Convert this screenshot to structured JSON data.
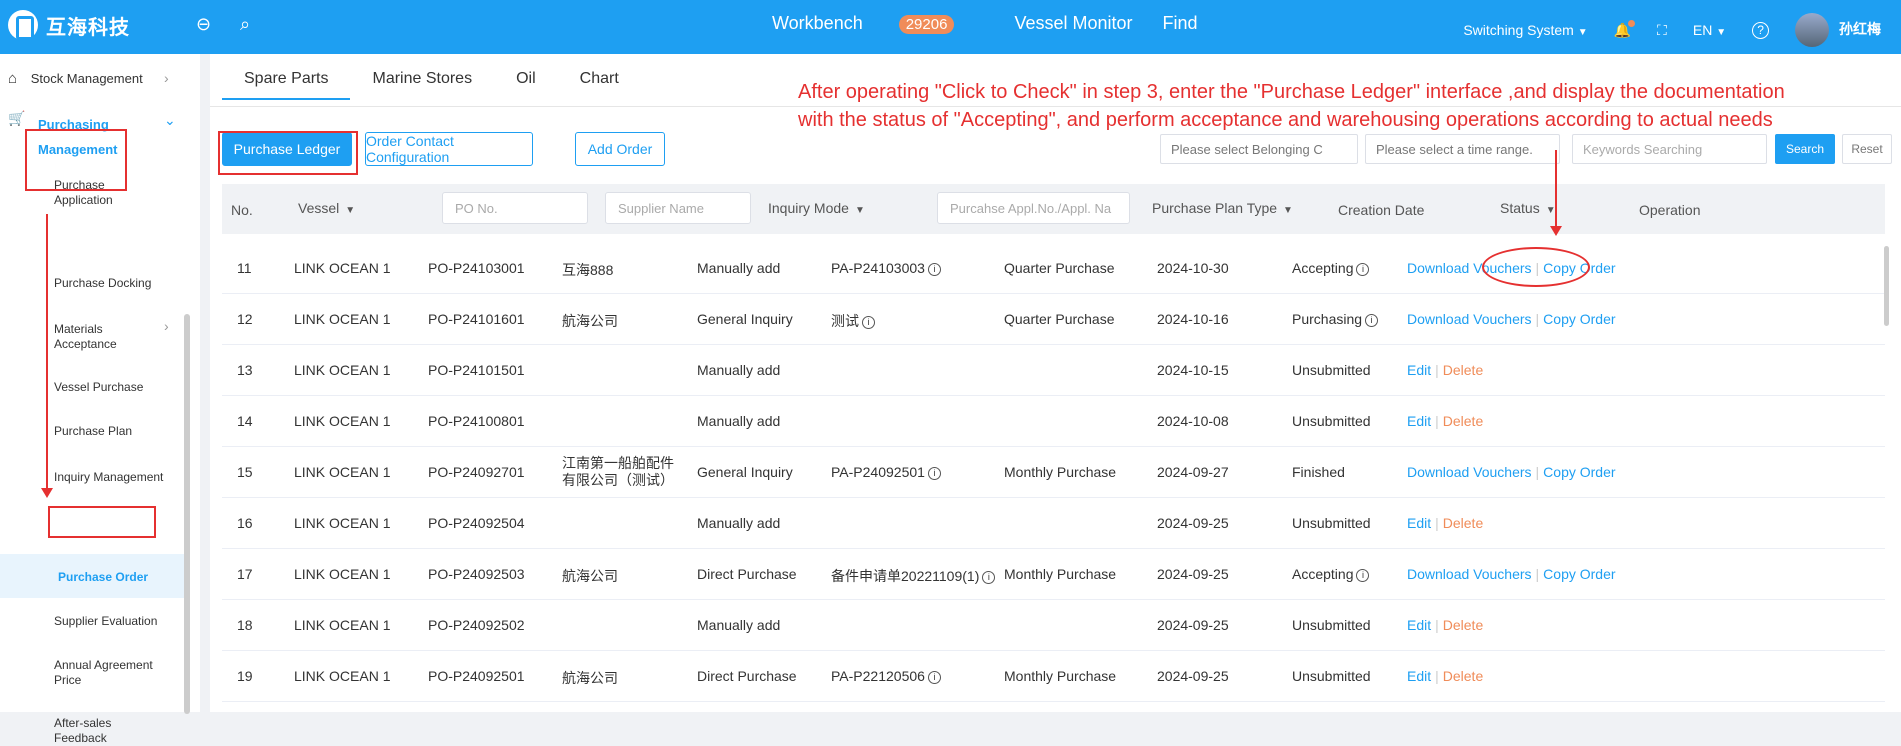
{
  "app": {
    "logo_text": "互海科技"
  },
  "topnav": {
    "workbench": "Workbench",
    "workbench_count": "29206",
    "vessel_monitor": "Vessel Monitor",
    "find": "Find"
  },
  "topright": {
    "switch_system": "Switching System",
    "language": "EN",
    "user_name": "孙红梅"
  },
  "sidebar": {
    "stock_management": "Stock Management",
    "purchasing_management_line1": "Purchasing",
    "purchasing_management_line2": "Management",
    "items": [
      "Purchase Application",
      "Purchase Docking",
      "Materials Acceptance",
      "Vessel Purchase",
      "Purchase Plan",
      "Inquiry Management",
      "Purchase Order",
      "Supplier Evaluation",
      "Annual Agreement Price",
      "After-sales Feedback"
    ]
  },
  "tabs": [
    "Spare Parts",
    "Marine Stores",
    "Oil",
    "Chart"
  ],
  "annotation": {
    "line1": "After operating \"Click to Check\" in step 3, enter the \"Purchase Ledger\" interface ,and display the documentation",
    "line2": "with the status of \"Accepting\", and perform acceptance and warehousing operations according to actual needs"
  },
  "toolbar": {
    "purchase_ledger": "Purchase Ledger",
    "order_contact_config": "Order Contact Configuration",
    "add_order": "Add Order",
    "belonging_placeholder": "Please select Belonging C",
    "time_range_placeholder": "Please select a time range.",
    "keywords_placeholder": "Keywords Searching",
    "search": "Search",
    "reset": "Reset"
  },
  "table": {
    "headers": {
      "no": "No.",
      "vessel": "Vessel",
      "po_placeholder": "PO No.",
      "supplier_placeholder": "Supplier Name",
      "inquiry_mode": "Inquiry Mode",
      "appl_placeholder": "Purcahse Appl.No./Appl. Na",
      "plan_type": "Purchase Plan Type",
      "creation_date": "Creation Date",
      "status": "Status",
      "operation": "Operation"
    },
    "rows": [
      {
        "no": "11",
        "vessel": "LINK OCEAN 1",
        "po": "PO-P24103001",
        "supplier": "互海888",
        "mode": "Manually add",
        "appl": "PA-P24103003",
        "plan": "Quarter Purchase",
        "date": "2024-10-30",
        "status": "Accepting",
        "status_info": true,
        "op1": "Download Vouchers",
        "op2": "Copy Order"
      },
      {
        "no": "12",
        "vessel": "LINK OCEAN 1",
        "po": "PO-P24101601",
        "supplier": "航海公司",
        "mode": "General Inquiry",
        "appl": "测试",
        "plan": "Quarter Purchase",
        "date": "2024-10-16",
        "status": "Purchasing",
        "status_info": true,
        "op1": "Download Vouchers",
        "op2": "Copy Order"
      },
      {
        "no": "13",
        "vessel": "LINK OCEAN 1",
        "po": "PO-P24101501",
        "supplier": "",
        "mode": "Manually add",
        "appl": "",
        "plan": "",
        "date": "2024-10-15",
        "status": "Unsubmitted",
        "status_info": false,
        "op1": "Edit",
        "op2": "Delete"
      },
      {
        "no": "14",
        "vessel": "LINK OCEAN 1",
        "po": "PO-P24100801",
        "supplier": "",
        "mode": "Manually add",
        "appl": "",
        "plan": "",
        "date": "2024-10-08",
        "status": "Unsubmitted",
        "status_info": false,
        "op1": "Edit",
        "op2": "Delete"
      },
      {
        "no": "15",
        "vessel": "LINK OCEAN 1",
        "po": "PO-P24092701",
        "supplier": "江南第一船舶配件有限公司（测试）",
        "mode": "General Inquiry",
        "appl": "PA-P24092501",
        "plan": "Monthly Purchase",
        "date": "2024-09-27",
        "status": "Finished",
        "status_info": false,
        "op1": "Download Vouchers",
        "op2": "Copy Order"
      },
      {
        "no": "16",
        "vessel": "LINK OCEAN 1",
        "po": "PO-P24092504",
        "supplier": "",
        "mode": "Manually add",
        "appl": "",
        "plan": "",
        "date": "2024-09-25",
        "status": "Unsubmitted",
        "status_info": false,
        "op1": "Edit",
        "op2": "Delete"
      },
      {
        "no": "17",
        "vessel": "LINK OCEAN 1",
        "po": "PO-P24092503",
        "supplier": "航海公司",
        "mode": "Direct Purchase",
        "appl": "备件申请单20221109(1)",
        "plan": "Monthly Purchase",
        "date": "2024-09-25",
        "status": "Accepting",
        "status_info": true,
        "op1": "Download Vouchers",
        "op2": "Copy Order"
      },
      {
        "no": "18",
        "vessel": "LINK OCEAN 1",
        "po": "PO-P24092502",
        "supplier": "",
        "mode": "Manually add",
        "appl": "",
        "plan": "",
        "date": "2024-09-25",
        "status": "Unsubmitted",
        "status_info": false,
        "op1": "Edit",
        "op2": "Delete"
      },
      {
        "no": "19",
        "vessel": "LINK OCEAN 1",
        "po": "PO-P24092501",
        "supplier": "航海公司",
        "mode": "Direct Purchase",
        "appl": "PA-P22120506",
        "plan": "Monthly Purchase",
        "date": "2024-09-25",
        "status": "Unsubmitted",
        "status_info": false,
        "op1": "Edit",
        "op2": "Delete"
      }
    ]
  }
}
